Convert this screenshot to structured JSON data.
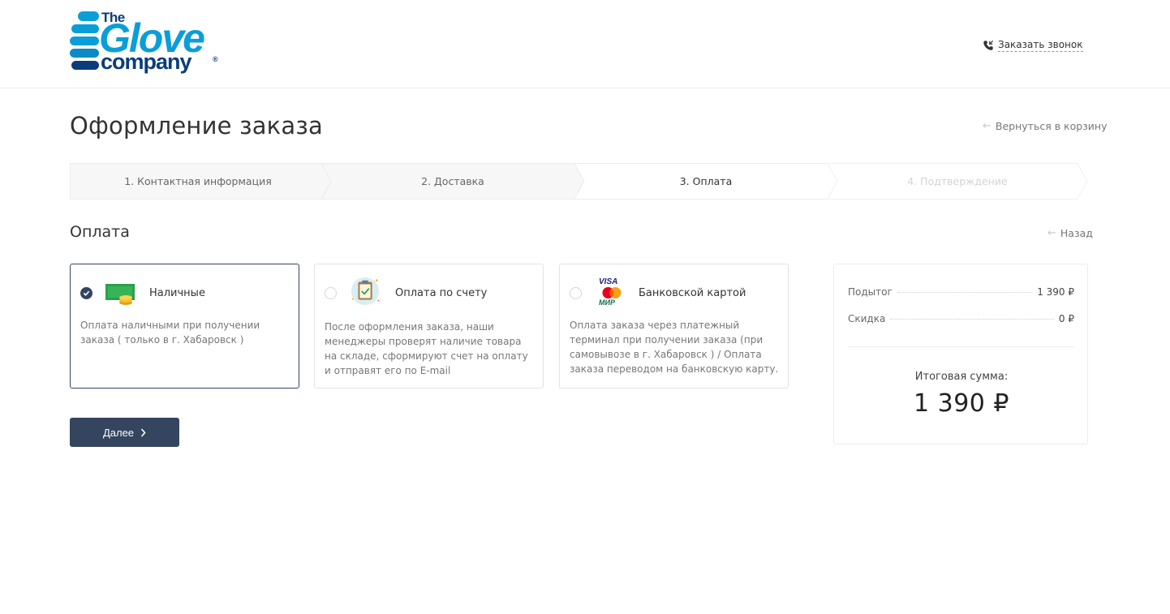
{
  "brand": {
    "line1": "The",
    "line2": "Glove",
    "line3": "company",
    "reg": "®"
  },
  "header": {
    "callback_label": "Заказать звонок"
  },
  "page": {
    "title": "Оформление заказа",
    "back_to_cart": "Вернуться в корзину"
  },
  "steps": [
    {
      "label": "1. Контактная информация",
      "state": "done"
    },
    {
      "label": "2. Доставка",
      "state": "done"
    },
    {
      "label": "3. Оплата",
      "state": "active"
    },
    {
      "label": "4. Подтверждение",
      "state": "future"
    }
  ],
  "section": {
    "title": "Оплата",
    "back_label": "Назад"
  },
  "payment_methods": [
    {
      "name": "Наличные",
      "description": "Оплата наличными при получении заказа ( только в г. Хабаровск )",
      "selected": true,
      "icon": "cash-icon"
    },
    {
      "name": "Оплата по счету",
      "description": "После оформления заказа, наши менеджеры проверят наличие товара на складе, сформируют счет на оплату и отправят его по E-mail",
      "selected": false,
      "icon": "invoice-icon"
    },
    {
      "name": "Банковской картой",
      "description": "Оплата заказа через платежный терминал при получении заказа (при самовывозе в г. Хабаровск ) / Оплата заказа переводом на банковскую карту.",
      "selected": false,
      "icon": "bank-card-icon",
      "card_logos": {
        "visa": "VISA",
        "mir": "МИР"
      }
    }
  ],
  "summary": {
    "subtotal_label": "Подытог",
    "subtotal_value": "1 390 ₽",
    "discount_label": "Скидка",
    "discount_value": "0 ₽",
    "total_label": "Итоговая сумма:",
    "total_value": "1 390 ₽"
  },
  "actions": {
    "next_label": "Далее"
  },
  "colors": {
    "primary": "#354560",
    "brand_light": "#0a9ed9",
    "brand_dark": "#0b3d7a"
  }
}
